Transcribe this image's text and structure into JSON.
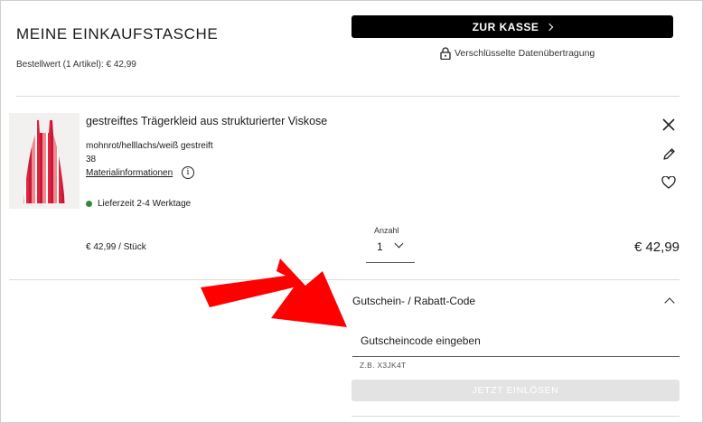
{
  "header": {
    "title": "MEINE EINKAUFSTASCHE",
    "order_value": "Bestellwert (1 Artikel): € 42,99",
    "checkout_label": "ZUR KASSE",
    "secure_text": "Verschlüsselte Datenübertragung"
  },
  "product": {
    "name": "gestreiftes Trägerkleid aus strukturierter Viskose",
    "color": "mohnrot/helllachs/weiß gestreift",
    "size": "38",
    "material_link": "Materialinformationen",
    "info_glyph": "i",
    "delivery": "Lieferzeit 2-4 Werktage",
    "unit_price": "€ 42,99 / Stück",
    "quantity_label": "Anzahl",
    "quantity": "1",
    "total": "€ 42,99",
    "stripe_colors": [
      "#c8183a",
      "#f08a8c",
      "#ffffff",
      "#e0243f"
    ]
  },
  "actions": {
    "remove_icon": "close-icon",
    "edit_icon": "pencil-icon",
    "wishlist_icon": "heart-icon"
  },
  "coupon": {
    "header": "Gutschein- / Rabatt-Code",
    "placeholder": "Gutscheincode eingeben",
    "hint": "Z.B. X3JK4T",
    "redeem_label": "JETZT EINLÖSEN"
  },
  "annotation": {
    "arrow_color": "#ff0000"
  }
}
